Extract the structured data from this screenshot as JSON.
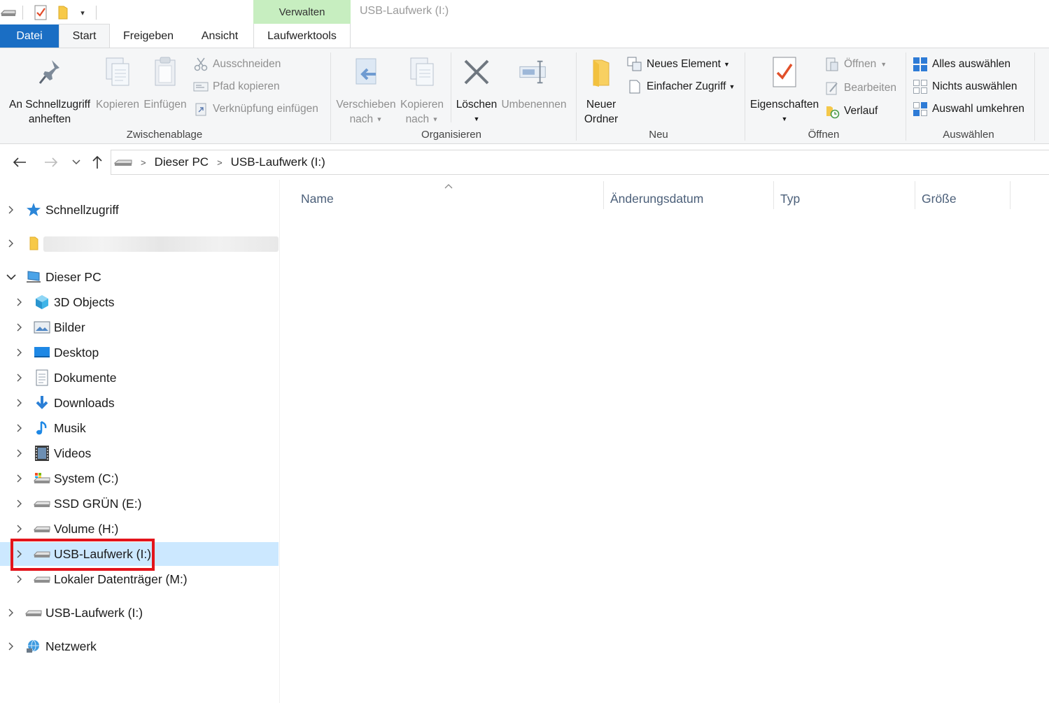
{
  "window": {
    "title": "USB-Laufwerk (I:)",
    "context_tab_header": "Verwalten"
  },
  "tabs": {
    "datei": "Datei",
    "start": "Start",
    "freigeben": "Freigeben",
    "ansicht": "Ansicht",
    "laufwerktools": "Laufwerktools"
  },
  "ribbon": {
    "zwischenablage": {
      "label": "Zwischenablage",
      "pin_line1": "An Schnellzugriff",
      "pin_line2": "anheften",
      "kopieren": "Kopieren",
      "einfuegen": "Einfügen",
      "ausschneiden": "Ausschneiden",
      "pfad_kopieren": "Pfad kopieren",
      "verknuepfung": "Verknüpfung einfügen"
    },
    "organisieren": {
      "label": "Organisieren",
      "verschieben_line1": "Verschieben",
      "verschieben_line2": "nach",
      "kopieren_line1": "Kopieren",
      "kopieren_line2": "nach",
      "loeschen": "Löschen",
      "umbenennen": "Umbenennen"
    },
    "neu": {
      "label": "Neu",
      "ordner_line1": "Neuer",
      "ordner_line2": "Ordner",
      "neues_element": "Neues Element",
      "einfacher_zugriff": "Einfacher Zugriff"
    },
    "oeffnen": {
      "label": "Öffnen",
      "eigenschaften": "Eigenschaften",
      "oeffnen": "Öffnen",
      "bearbeiten": "Bearbeiten",
      "verlauf": "Verlauf"
    },
    "auswaehlen": {
      "label": "Auswählen",
      "alles": "Alles auswählen",
      "nichts": "Nichts auswählen",
      "umkehren": "Auswahl umkehren"
    }
  },
  "address": {
    "crumbs": [
      "Dieser PC",
      "USB-Laufwerk (I:)"
    ]
  },
  "nav": {
    "schnellzugriff": "Schnellzugriff",
    "dieser_pc": "Dieser PC",
    "children": [
      {
        "label": "3D Objects",
        "icon": "3d-objects-icon"
      },
      {
        "label": "Bilder",
        "icon": "pictures-icon"
      },
      {
        "label": "Desktop",
        "icon": "desktop-icon"
      },
      {
        "label": "Dokumente",
        "icon": "documents-icon"
      },
      {
        "label": "Downloads",
        "icon": "downloads-icon"
      },
      {
        "label": "Musik",
        "icon": "music-icon"
      },
      {
        "label": "Videos",
        "icon": "videos-icon"
      },
      {
        "label": "System (C:)",
        "icon": "system-drive-icon"
      },
      {
        "label": "SSD GRÜN (E:)",
        "icon": "drive-icon"
      },
      {
        "label": "Volume (H:)",
        "icon": "drive-icon"
      },
      {
        "label": "USB-Laufwerk (I:)",
        "icon": "usb-drive-icon",
        "selected": true
      },
      {
        "label": "Lokaler Datenträger (M:)",
        "icon": "drive-icon"
      }
    ],
    "usb_root": "USB-Laufwerk (I:)",
    "netzwerk": "Netzwerk"
  },
  "columns": {
    "name": "Name",
    "date": "Änderungsdatum",
    "type": "Typ",
    "size": "Größe"
  },
  "colors": {
    "accent": "#1a6ec4",
    "context_tab": "#c7eec0",
    "selection": "#cce8ff",
    "highlight_box": "#e3141b"
  }
}
